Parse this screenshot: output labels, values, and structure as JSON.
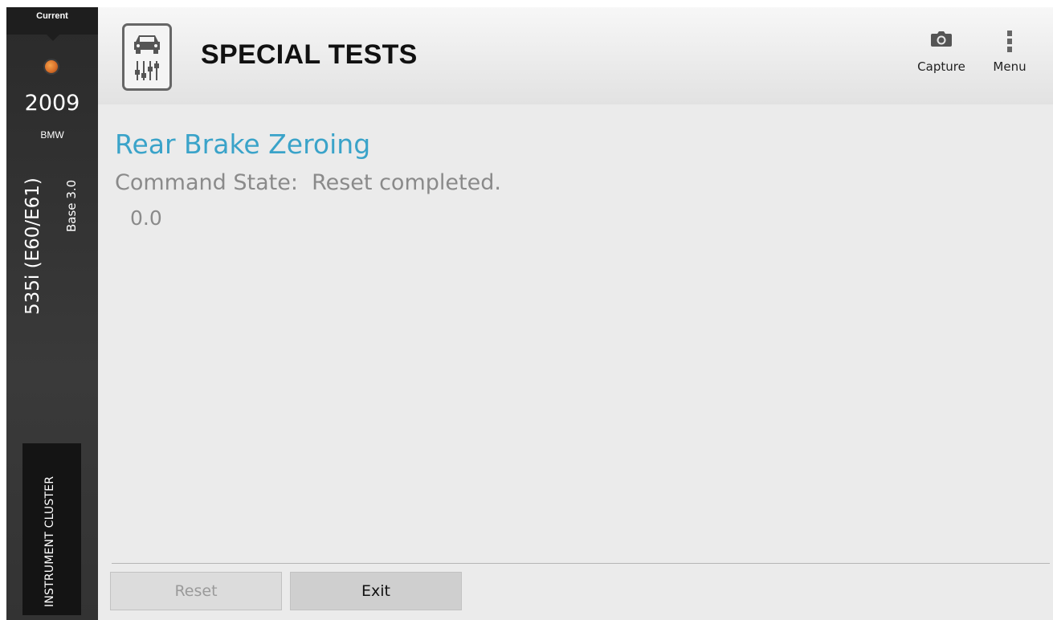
{
  "sidebar": {
    "current_label": "Current",
    "year": "2009",
    "make": "BMW",
    "model": "535i (E60/E61)",
    "trim": "Base 3.0",
    "module": "INSTRUMENT CLUSTER"
  },
  "header": {
    "title": "SPECIAL TESTS",
    "capture_label": "Capture",
    "menu_label": "Menu",
    "app_icon": "car-diagnostics-icon"
  },
  "main": {
    "test_title": "Rear Brake Zeroing",
    "command_state": "Command State:  Reset completed.",
    "value": "0.0"
  },
  "buttons": {
    "reset_label": "Reset",
    "exit_label": "Exit"
  },
  "colors": {
    "accent": "#3aa3c9",
    "status_dot": "#e07a2e",
    "sidebar_bg": "#333333"
  }
}
